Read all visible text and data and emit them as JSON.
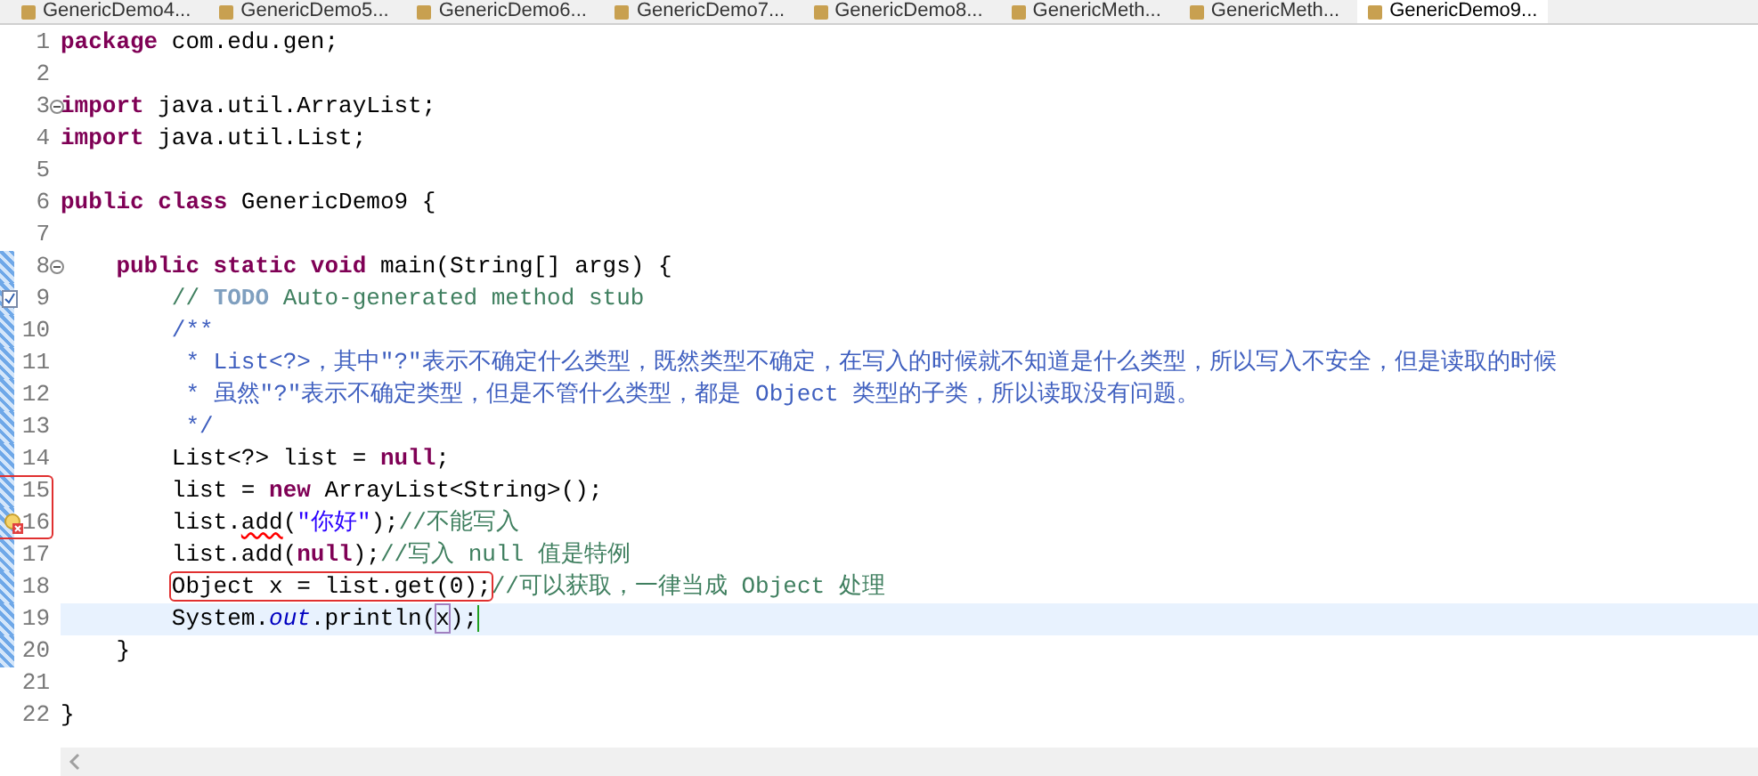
{
  "tabs": [
    {
      "label": "GenericDemo4...",
      "selected": false
    },
    {
      "label": "GenericDemo5...",
      "selected": false
    },
    {
      "label": "GenericDemo6...",
      "selected": false
    },
    {
      "label": "GenericDemo7...",
      "selected": false
    },
    {
      "label": "GenericDemo8...",
      "selected": false
    },
    {
      "label": "GenericMeth...",
      "selected": false
    },
    {
      "label": "GenericMeth...",
      "selected": false
    },
    {
      "label": "GenericDemo9...",
      "selected": true
    }
  ],
  "lines": [
    {
      "number": "1",
      "kind": "plain",
      "changed": false,
      "current": false,
      "flagged": false,
      "tokens": [
        {
          "kind": "kw",
          "text": "package"
        },
        {
          "kind": "txt",
          "text": " com.edu.gen;"
        }
      ]
    },
    {
      "number": "2",
      "kind": "plain",
      "changed": false,
      "current": false,
      "flagged": false
    },
    {
      "number": "3",
      "kind": "fold",
      "changed": false,
      "current": false,
      "flagged": false,
      "tokens": [
        {
          "kind": "kw",
          "text": "import"
        },
        {
          "kind": "txt",
          "text": " java.util.ArrayList;"
        }
      ]
    },
    {
      "number": "4",
      "kind": "plain",
      "changed": false,
      "current": false,
      "flagged": false,
      "tokens": [
        {
          "kind": "kw",
          "text": "import"
        },
        {
          "kind": "txt",
          "text": " java.util.List;"
        }
      ]
    },
    {
      "number": "5",
      "kind": "plain",
      "changed": false,
      "current": false,
      "flagged": false
    },
    {
      "number": "6",
      "kind": "plain",
      "changed": false,
      "current": false,
      "flagged": false,
      "tokens": [
        {
          "kind": "kw",
          "text": "public class"
        },
        {
          "kind": "txt",
          "text": " GenericDemo9 {"
        }
      ],
      "children": [
        {
          "number": "7",
          "kind": "plain",
          "changed": false,
          "current": false,
          "flagged": false
        },
        {
          "number": "8",
          "kind": "fold",
          "changed": true,
          "current": false,
          "flagged": false,
          "tokens": [
            {
              "kind": "kw",
              "text": "public static void"
            },
            {
              "kind": "txt",
              "text": " main(String[] args) {"
            }
          ],
          "children": [
            {
              "number": "9",
              "kind": "task",
              "changed": true,
              "current": false,
              "flagged": false,
              "tokens": [
                {
                  "kind": "cmt",
                  "text": "// "
                },
                {
                  "kind": "task",
                  "text": "TODO"
                },
                {
                  "kind": "cmt",
                  "text": " Auto-generated method stub"
                }
              ]
            },
            {
              "number": "10",
              "kind": "plain",
              "changed": true,
              "current": false,
              "flagged": false,
              "tokens": [
                {
                  "kind": "doc",
                  "text": "/**"
                }
              ]
            },
            {
              "number": "11",
              "kind": "plain",
              "changed": true,
              "current": false,
              "flagged": false,
              "tokens": [
                {
                  "kind": "doc",
                  "text": " * List<?>，其中\"?\"表示不确定什么类型，既然类型不确定，在写入的时候就不知道是什么类型，所以写入不安全，但是读取的时候"
                }
              ]
            },
            {
              "number": "12",
              "kind": "plain",
              "changed": true,
              "current": false,
              "flagged": false,
              "tokens": [
                {
                  "kind": "doc",
                  "text": " * 虽然\"?\"表示不确定类型，但是不管什么类型，都是 Object 类型的子类，所以读取没有问题。"
                }
              ]
            },
            {
              "number": "13",
              "kind": "plain",
              "changed": true,
              "current": false,
              "flagged": false,
              "tokens": [
                {
                  "kind": "doc",
                  "text": " */"
                }
              ]
            },
            {
              "number": "14",
              "kind": "plain",
              "changed": true,
              "current": false,
              "flagged": false,
              "tokens": [
                {
                  "kind": "txt",
                  "text": "List<?> list = "
                },
                {
                  "kind": "kw",
                  "text": "null"
                },
                {
                  "kind": "txt",
                  "text": ";"
                }
              ]
            },
            {
              "number": "15",
              "kind": "plain",
              "changed": true,
              "current": false,
              "flagged": true,
              "tokens": [
                {
                  "kind": "txt",
                  "text": "list = "
                },
                {
                  "kind": "kw",
                  "text": "new"
                },
                {
                  "kind": "txt",
                  "text": " ArrayList<String>();"
                }
              ]
            },
            {
              "number": "16",
              "kind": "warning",
              "changed": true,
              "current": false,
              "flagged": true,
              "tokens": [
                {
                  "kind": "txt",
                  "text": "list."
                },
                {
                  "kind": "error",
                  "text": "add"
                },
                {
                  "kind": "txt",
                  "text": "("
                },
                {
                  "kind": "str",
                  "text": "\"你好\""
                },
                {
                  "kind": "txt",
                  "text": ");"
                },
                {
                  "kind": "cmt",
                  "text": "//不能写入"
                }
              ]
            },
            {
              "number": "17",
              "kind": "plain",
              "changed": true,
              "current": false,
              "flagged": false,
              "tokens": [
                {
                  "kind": "txt",
                  "text": "list.add("
                },
                {
                  "kind": "kw",
                  "text": "null"
                },
                {
                  "kind": "txt",
                  "text": ");"
                },
                {
                  "kind": "cmt",
                  "text": "//写入 null 值是特例"
                }
              ]
            },
            {
              "number": "18",
              "kind": "plain",
              "changed": true,
              "current": false,
              "flagged": false,
              "tokens": [
                {
                  "kind": "box",
                  "text": "Object x = list.get(0);"
                },
                {
                  "kind": "cmt",
                  "text": "//可以获取，一律当成 Object 处理"
                }
              ]
            },
            {
              "number": "19",
              "kind": "plain",
              "changed": true,
              "current": true,
              "flagged": false,
              "tokens": [
                {
                  "kind": "txt",
                  "text": "System."
                },
                {
                  "kind": "fld",
                  "text": "out"
                },
                {
                  "kind": "txt",
                  "text": ".println("
                },
                {
                  "kind": "match",
                  "text": "x"
                },
                {
                  "kind": "txt",
                  "text": ");"
                }
              ]
            }
          ]
        },
        {
          "number": "20",
          "kind": "plain",
          "changed": true,
          "current": false,
          "flagged": false,
          "tokens": [
            {
              "kind": "txt",
              "text": "}"
            }
          ]
        },
        {
          "number": "21",
          "kind": "plain",
          "changed": false,
          "current": false,
          "flagged": false
        }
      ]
    },
    {
      "number": "22",
      "kind": "plain",
      "changed": false,
      "current": false,
      "flagged": false,
      "tokens": [
        {
          "kind": "txt",
          "text": "}"
        }
      ]
    }
  ]
}
